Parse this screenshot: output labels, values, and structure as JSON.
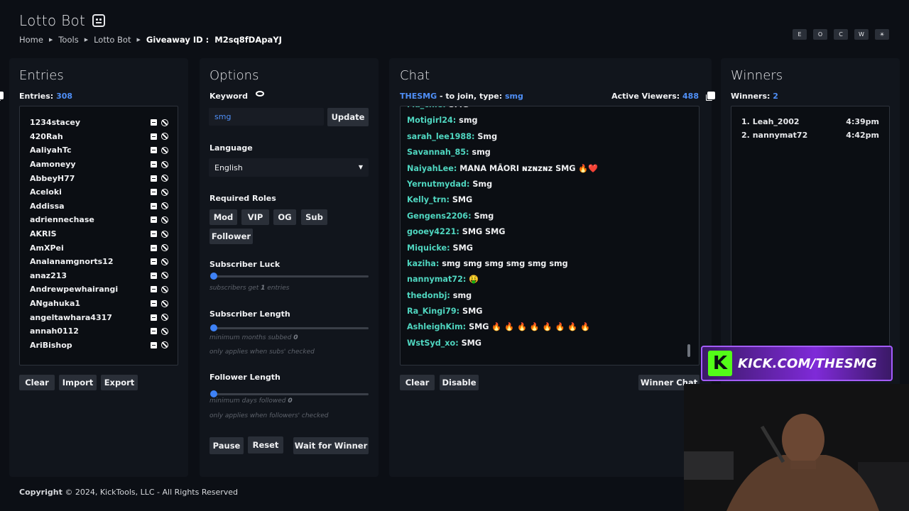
{
  "header": {
    "title": "Lotto Bot",
    "breadcrumbs": [
      "Home",
      "Tools",
      "Lotto Bot"
    ],
    "giveaway_label": "Giveaway ID :",
    "giveaway_id": "M2sq8fDApaYJ",
    "theme_buttons": [
      "E",
      "O",
      "C",
      "W",
      "☀"
    ]
  },
  "entries": {
    "title": "Entries",
    "count_label": "Entries:",
    "count": "308",
    "items": [
      "1234stacey",
      "420Rah",
      "AaliyahTc",
      "Aamoneyy",
      "AbbeyH77",
      "Aceloki",
      "Addissa",
      "adriennechase",
      "AKRIS",
      "AmXPei",
      "Analanamgnorts12",
      "anaz213",
      "Andrewpewhairangi",
      "ANgahuka1",
      "angeltawhara4317",
      "annah0112",
      "AriBishop"
    ],
    "buttons": {
      "clear": "Clear",
      "import": "Import",
      "export": "Export"
    }
  },
  "options": {
    "title": "Options",
    "keyword_label": "Keyword",
    "keyword_value": "smg",
    "update_label": "Update",
    "language_label": "Language",
    "language_value": "English",
    "roles_label": "Required Roles",
    "roles": [
      "Mod",
      "VIP",
      "OG",
      "Sub",
      "Follower"
    ],
    "sub_luck_label": "Subscriber Luck",
    "sub_luck_hint_pre": "subscribers get",
    "sub_luck_value": "1",
    "sub_luck_hint_post": "entries",
    "sub_length_label": "Subscriber Length",
    "sub_length_hint": "minimum months subbed",
    "sub_length_value": "0",
    "sub_length_note": "only applies when subs' checked",
    "follow_length_label": "Follower Length",
    "follow_length_hint": "minimum days followed",
    "follow_length_value": "0",
    "follow_length_note": "only applies when followers' checked",
    "buttons": {
      "pause": "Pause",
      "reset": "Reset",
      "wait": "Wait for Winner"
    }
  },
  "chat": {
    "title": "Chat",
    "channel": "THESMG",
    "join_text": "- to join, type:",
    "join_keyword": "smg",
    "viewers_label": "Active Viewers:",
    "viewers": "488",
    "messages": [
      {
        "user": "Ma_chie:",
        "text": "SMG"
      },
      {
        "user": "Motigirl24:",
        "text": "smg"
      },
      {
        "user": "sarah_lee1988:",
        "text": "Smg"
      },
      {
        "user": "Savannah_85:",
        "text": "smg"
      },
      {
        "user": "NaiyahLee:",
        "text": "MANA MĀORI ɴzɴzɴz SMG 🔥❤️"
      },
      {
        "user": "Yernutmydad:",
        "text": "Smg"
      },
      {
        "user": "Kelly_trn:",
        "text": "SMG"
      },
      {
        "user": "Gengens2206:",
        "text": "Smg"
      },
      {
        "user": "gooey4221:",
        "text": "SMG SMG"
      },
      {
        "user": "Miquicke:",
        "text": "SMG"
      },
      {
        "user": "kaziha:",
        "text": "smg smg smg smg smg smg"
      },
      {
        "user": "nannymat72:",
        "text": "🤑"
      },
      {
        "user": "thedonbj:",
        "text": "smg"
      },
      {
        "user": "Ra_Kingi79:",
        "text": "SMG"
      },
      {
        "user": "AshleighKim:",
        "text": "SMG 🔥 🔥 🔥 🔥 🔥 🔥 🔥 🔥"
      },
      {
        "user": "WstSyd_xo:",
        "text": "SMG"
      }
    ],
    "buttons": {
      "clear": "Clear",
      "disable": "Disable",
      "winner_chat": "Winner Chat"
    }
  },
  "winners": {
    "title": "Winners",
    "count_label": "Winners:",
    "count": "2",
    "items": [
      {
        "rank": "1.",
        "name": "Leah_2002",
        "time": "4:39pm"
      },
      {
        "rank": "2.",
        "name": "nannymat72",
        "time": "4:42pm"
      }
    ]
  },
  "overlay": {
    "kick_text": "KICK.COM/THESMG"
  },
  "footer": {
    "bold": "Copyright",
    "text": "© 2024, KickTools, LLC - All Rights Reserved"
  },
  "colors": {
    "accent": "#4f8ff7",
    "username": "#4fd6c0",
    "kick_green": "#53fc18",
    "kick_purple": "#7f2ad8"
  }
}
